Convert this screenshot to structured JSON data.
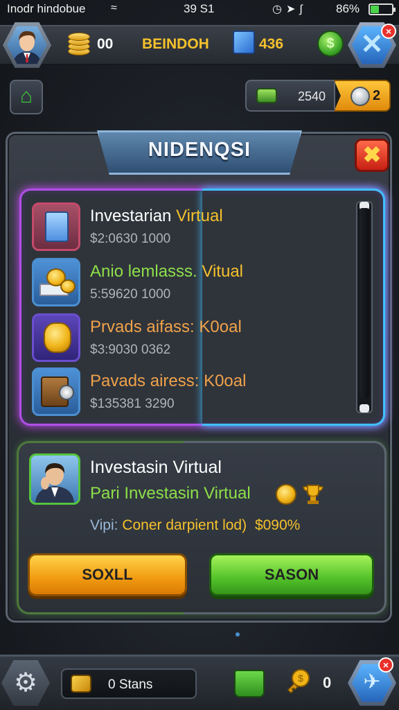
{
  "status_bar": {
    "carrier": "Inodr hindobue",
    "time": "39 S1",
    "battery_percent": "86%"
  },
  "top_bar": {
    "coins": "00",
    "player_name": "BEINDOH",
    "gems": "436"
  },
  "resources": {
    "cash": "2540",
    "tokens": "2"
  },
  "dialog": {
    "title": "NIDENQSI",
    "items": [
      {
        "name": "Investarian Virtual",
        "name_parts": [
          "Investarian",
          " Virtual"
        ],
        "sub": "$2:0630 1000",
        "icon": "file-cabinet-icon"
      },
      {
        "name": "Anio lemlasss. Vitual",
        "name_parts": [
          "Anio lemlasss.",
          " Vitual"
        ],
        "sub": "5:59620 1000",
        "icon": "money-stack-icon"
      },
      {
        "name": "Prvads aifass: K0oal",
        "sub": "$3:9030 0362",
        "icon": "gold-coins-icon"
      },
      {
        "name": "Pavads airess: K0oal",
        "sub": "$135381 3290",
        "icon": "safe-icon"
      }
    ],
    "detail": {
      "title": "Investasin Virtual",
      "subtitle": "Pari Investasin Virtual",
      "info_label": "Vipi:",
      "info_text": "Coner darpient lod)",
      "info_value": "$090%"
    },
    "buttons": {
      "left": "SOXLL",
      "right": "SASON"
    }
  },
  "bottom_bar": {
    "stans": "0 Stans",
    "count": "0"
  },
  "colors": {
    "accent_gold": "#f5c12c",
    "accent_green": "#8ee04a",
    "accent_orange": "#f0a24a",
    "neon_pink": "#d34cff",
    "neon_blue": "#3fc0ff"
  }
}
